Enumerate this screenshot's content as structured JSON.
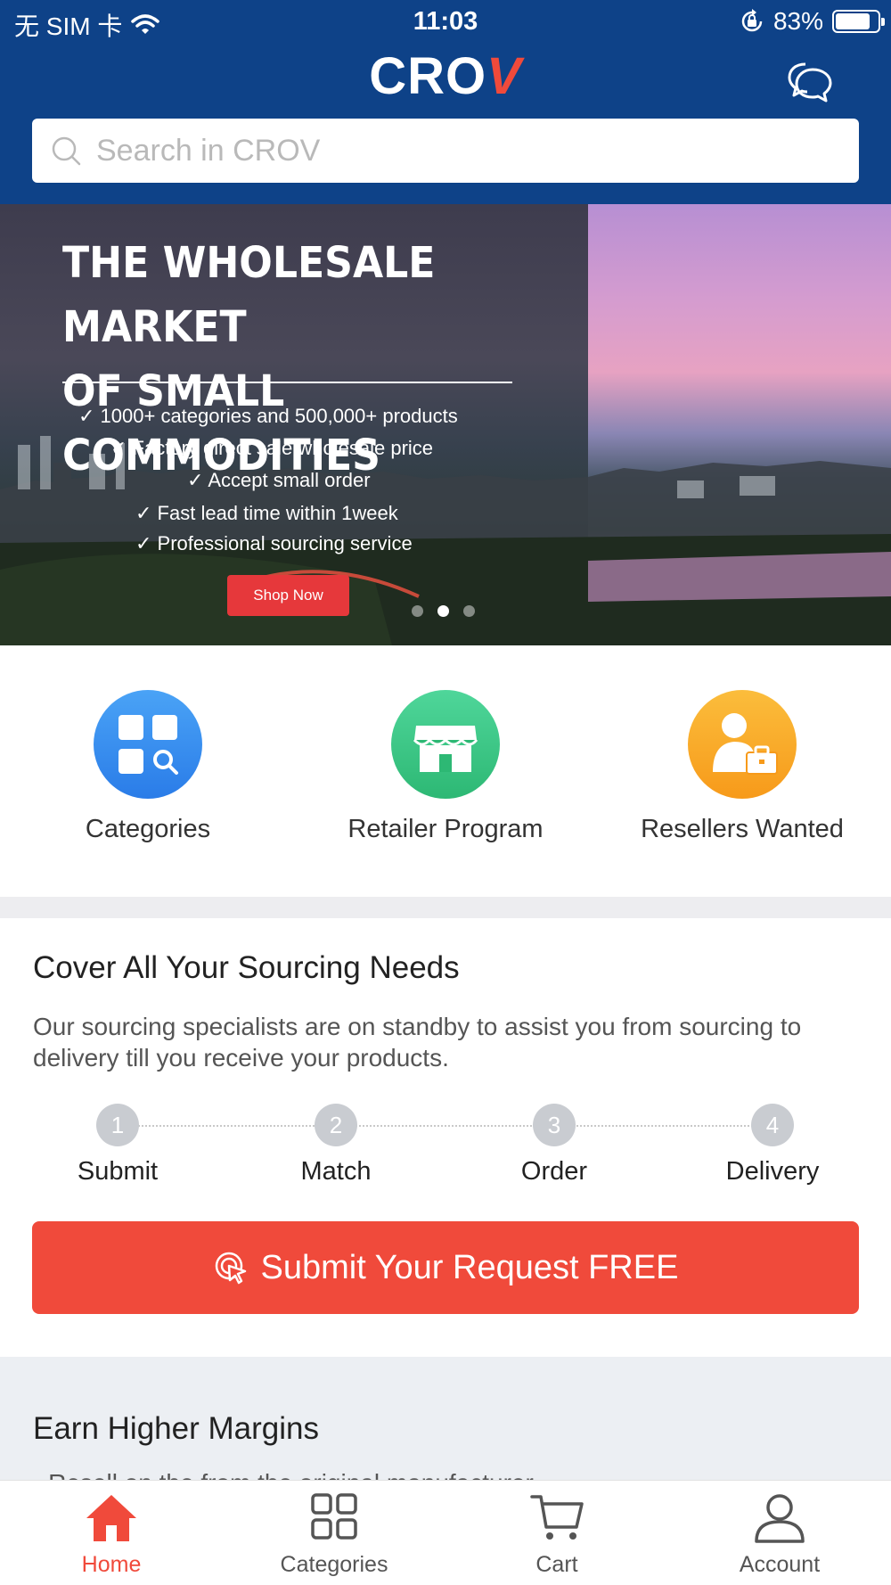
{
  "status_bar": {
    "carrier": "无 SIM 卡",
    "time": "11:03",
    "battery_percent": "83%",
    "battery_level": 0.83
  },
  "header": {
    "logo_main": "CRO",
    "logo_accent": "V",
    "chat_icon": "chat-bubbles-icon"
  },
  "search": {
    "placeholder": "Search in CROV",
    "value": ""
  },
  "banner": {
    "title_line1": "THE WHOLESALE MARKET",
    "title_line2": "OF SMALL COMMODITIES",
    "bullets": [
      "1000+ categories and 500,000+ products",
      "Factory direct sale,wholesale price",
      "Accept small order",
      "Fast lead time within 1week",
      "Professional sourcing service"
    ],
    "cta": "Shop Now",
    "slides": 3,
    "active_slide": 2
  },
  "quick_nav": [
    {
      "label": "Categories",
      "icon": "grid-search-icon",
      "color": "#2f8cf0"
    },
    {
      "label": "Retailer Program",
      "icon": "storefront-icon",
      "color": "#36c57e"
    },
    {
      "label": "Resellers Wanted",
      "icon": "person-briefcase-icon",
      "color": "#f9a820"
    }
  ],
  "sourcing": {
    "title": "Cover All Your Sourcing Needs",
    "description": "Our sourcing specialists are on standby to assist you from sourcing to delivery till you receive your products.",
    "steps": [
      {
        "number": "1",
        "label": "Submit"
      },
      {
        "number": "2",
        "label": "Match"
      },
      {
        "number": "3",
        "label": "Order"
      },
      {
        "number": "4",
        "label": "Delivery"
      }
    ],
    "button": "Submit Your Request FREE"
  },
  "earn": {
    "title": "Earn Higher Margins",
    "partial_text": "· Resell on the from the original manufacturer"
  },
  "tabbar": [
    {
      "label": "Home",
      "icon": "home-icon",
      "active": true
    },
    {
      "label": "Categories",
      "icon": "grid-icon",
      "active": false
    },
    {
      "label": "Cart",
      "icon": "cart-icon",
      "active": false
    },
    {
      "label": "Account",
      "icon": "person-icon",
      "active": false
    }
  ],
  "colors": {
    "brand_blue": "#0e4288",
    "accent_red": "#f04a3b"
  }
}
